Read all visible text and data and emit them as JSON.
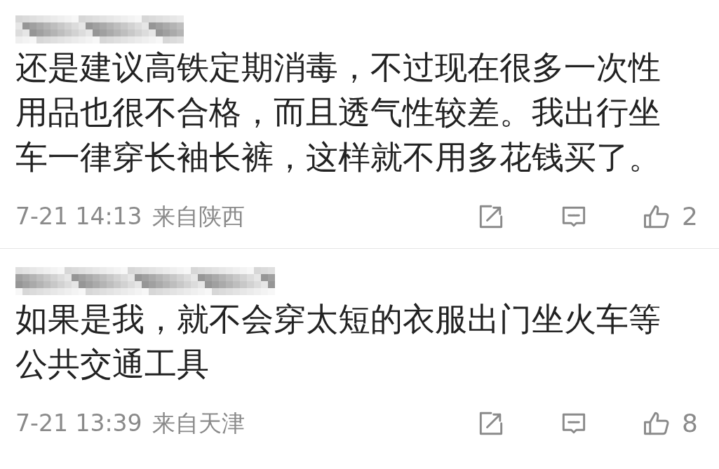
{
  "comments": [
    {
      "text": "还是建议高铁定期消毒，不过现在很多一次性用品也很不合格，而且透气性较差。我出行坐车一律穿长袖长裤，这样就不用多花钱买了。",
      "time": "7-21 14:13",
      "location": "来自陕西",
      "likes": "2"
    },
    {
      "text": "如果是我，就不会穿太短的衣服出门坐火车等公共交通工具",
      "time": "7-21 13:39",
      "location": "来自天津",
      "likes": "8"
    }
  ]
}
